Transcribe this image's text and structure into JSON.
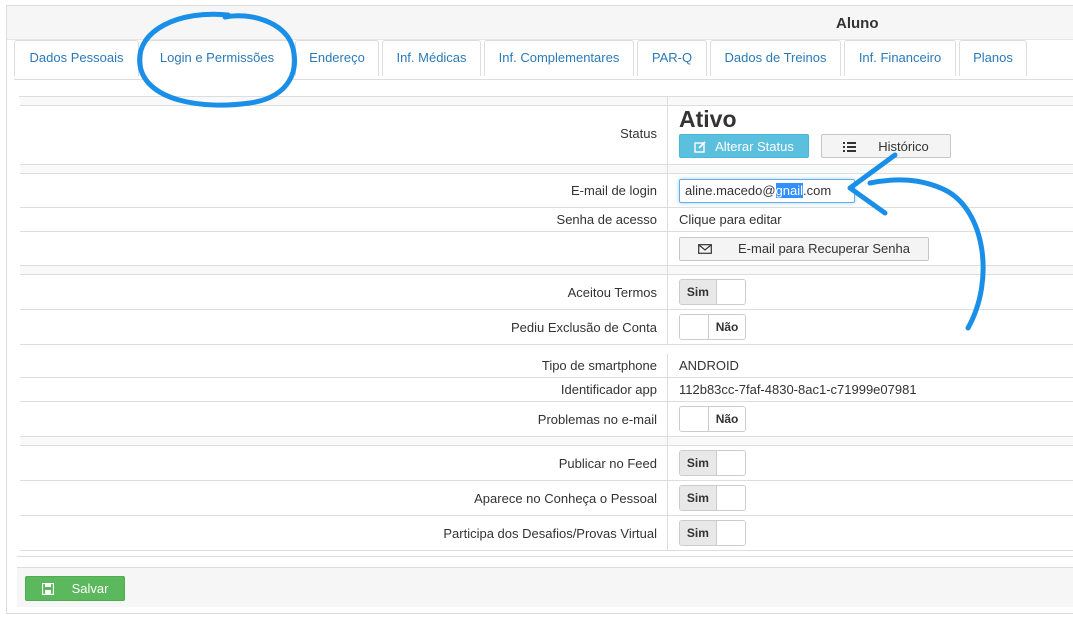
{
  "panel": {
    "title": "Aluno"
  },
  "tabs": [
    {
      "label": "Dados Pessoais"
    },
    {
      "label": "Login e Permissões"
    },
    {
      "label": "Endereço"
    },
    {
      "label": "Inf. Médicas"
    },
    {
      "label": "Inf. Complementares"
    },
    {
      "label": "PAR-Q"
    },
    {
      "label": "Dados de Treinos"
    },
    {
      "label": "Inf. Financeiro"
    },
    {
      "label": "Planos"
    }
  ],
  "status": {
    "label": "Status",
    "value": "Ativo",
    "change_button": "Alterar Status",
    "history_button": "Histórico"
  },
  "login": {
    "email_label": "E-mail de login",
    "email_before": "aline.macedo@",
    "email_selected": "gnail",
    "email_after": ".com",
    "password_label": "Senha de acesso",
    "password_value": "Clique para editar",
    "recover_button": "E-mail para Recuperar Senha"
  },
  "terms": {
    "label": "Aceitou Termos",
    "value": "Sim"
  },
  "deletion": {
    "label": "Pediu Exclusão de Conta",
    "value": "Não"
  },
  "smartphone": {
    "label": "Tipo de smartphone",
    "value": "ANDROID"
  },
  "app_id": {
    "label": "Identificador app",
    "value": "112b83cc-7faf-4830-8ac1-c71999e07981"
  },
  "email_problems": {
    "label": "Problemas no e-mail",
    "value": "Não"
  },
  "feed": {
    "label": "Publicar no Feed",
    "value": "Sim"
  },
  "people": {
    "label": "Aparece no Conheça o Pessoal",
    "value": "Sim"
  },
  "challenges": {
    "label": "Participa dos Desafios/Provas Virtual",
    "value": "Sim"
  },
  "footer": {
    "save_button": "Salvar"
  },
  "colors": {
    "link": "#2a7ab8",
    "info": "#5bc0de",
    "success": "#5cb85c",
    "annotation": "#1a8fe8"
  }
}
